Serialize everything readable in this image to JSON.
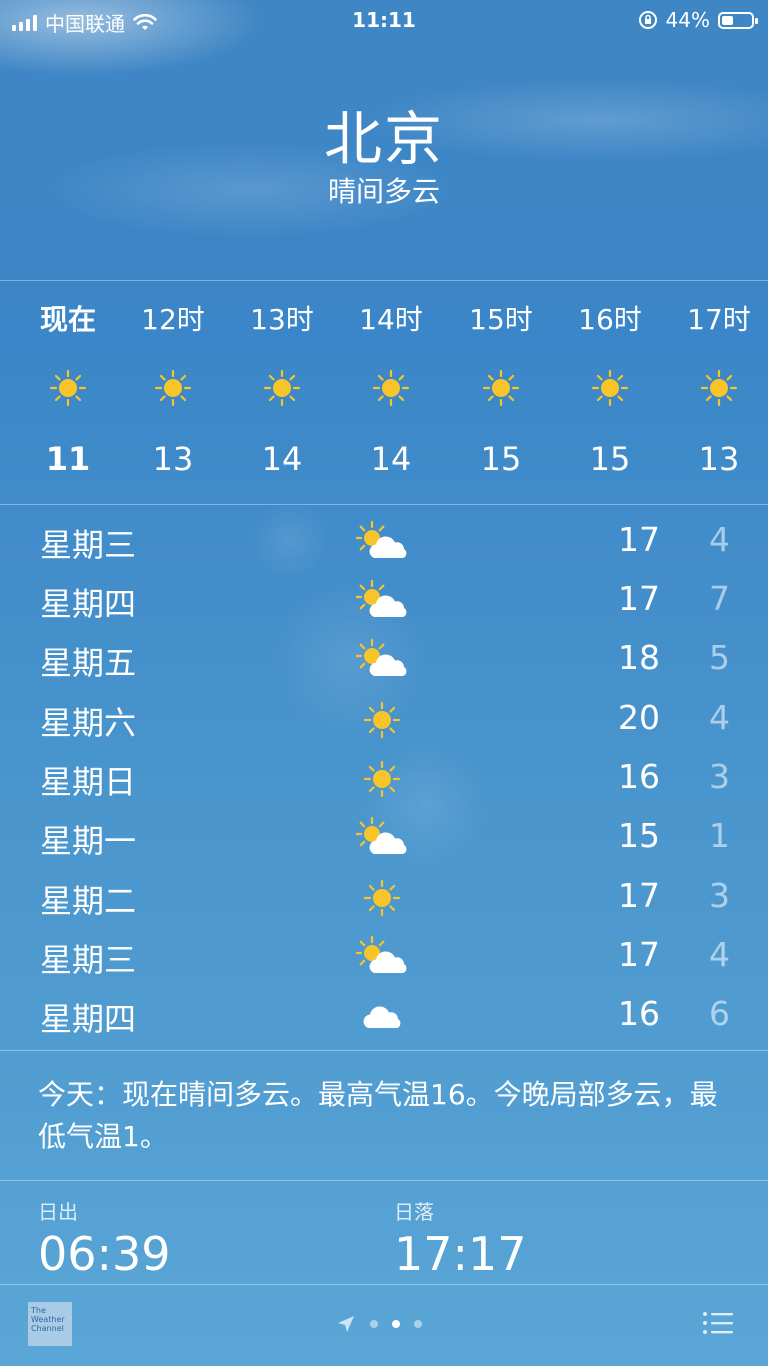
{
  "status_bar": {
    "carrier": "中国联通",
    "time": "11:11",
    "battery": "44%",
    "battery_level": 0.44,
    "icons": [
      "signal-icon",
      "wifi-icon",
      "orientation-lock-icon",
      "battery-icon"
    ]
  },
  "location": {
    "city": "北京",
    "condition": "晴间多云"
  },
  "hourly": [
    {
      "label": "现在",
      "icon": "sun-icon",
      "temp": "11"
    },
    {
      "label": "12时",
      "icon": "sun-icon",
      "temp": "13"
    },
    {
      "label": "13时",
      "icon": "sun-icon",
      "temp": "14"
    },
    {
      "label": "14时",
      "icon": "sun-icon",
      "temp": "14"
    },
    {
      "label": "15时",
      "icon": "sun-icon",
      "temp": "15"
    },
    {
      "label": "16时",
      "icon": "sun-icon",
      "temp": "15"
    },
    {
      "label": "17时",
      "icon": "sun-icon",
      "temp": "13"
    }
  ],
  "daily": [
    {
      "day": "星期三",
      "icon": "partly-cloudy-icon",
      "high": "17",
      "low": "4"
    },
    {
      "day": "星期四",
      "icon": "partly-cloudy-icon",
      "high": "17",
      "low": "7"
    },
    {
      "day": "星期五",
      "icon": "partly-cloudy-icon",
      "high": "18",
      "low": "5"
    },
    {
      "day": "星期六",
      "icon": "sun-icon",
      "high": "20",
      "low": "4"
    },
    {
      "day": "星期日",
      "icon": "sun-icon",
      "high": "16",
      "low": "3"
    },
    {
      "day": "星期一",
      "icon": "partly-cloudy-icon",
      "high": "15",
      "low": "1"
    },
    {
      "day": "星期二",
      "icon": "sun-icon",
      "high": "17",
      "low": "3"
    },
    {
      "day": "星期三",
      "icon": "partly-cloudy-icon",
      "high": "17",
      "low": "4"
    },
    {
      "day": "星期四",
      "icon": "cloud-icon",
      "high": "16",
      "low": "6"
    }
  ],
  "summary": "今天：现在晴间多云。最高气温16。今晚局部多云，最低气温1。",
  "sun": {
    "sunrise_label": "日出",
    "sunrise": "06:39",
    "sunset_label": "日落",
    "sunset": "17:17"
  },
  "footer": {
    "logo_text": "The Weather Channel",
    "page_count": 3,
    "active_page": 2,
    "icons": [
      "location-arrow-icon",
      "list-icon"
    ]
  },
  "colors": {
    "sun": "#f7c52a",
    "low_temp": "rgba(255,255,255,0.55)"
  }
}
